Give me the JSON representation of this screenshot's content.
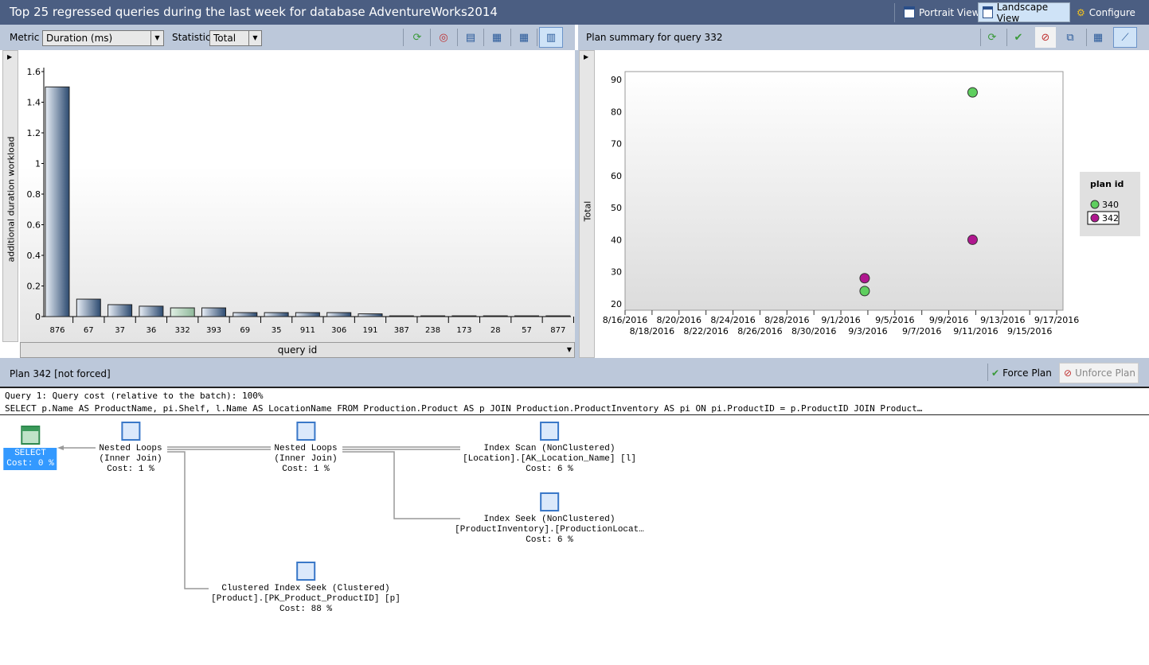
{
  "window": {
    "title": "Top 25 regressed queries during the last week for database AdventureWorks2014",
    "views": [
      {
        "label": "Portrait View",
        "active": false
      },
      {
        "label": "Landscape View",
        "active": true
      },
      {
        "label": "Configure",
        "active": false
      }
    ]
  },
  "left_toolbar": {
    "metric_label": "Metric",
    "metric_value": "Duration (ms)",
    "statistic_label": "Statistic",
    "statistic_value": "Total",
    "icons": [
      "refresh-icon",
      "track-query-icon",
      "view-query-icon",
      "grid-icon",
      "grid-detail-icon",
      "chart-icon"
    ]
  },
  "right_toolbar": {
    "title": "Plan summary for query 332",
    "icons": [
      "refresh-icon",
      "force-plan-icon",
      "unforce-plan-icon",
      "compare-plans-icon",
      "grid-icon",
      "chart-icon"
    ]
  },
  "plan_bar": {
    "title": "Plan 342 [not forced]",
    "force_label": "Force Plan",
    "unforce_label": "Unforce Plan"
  },
  "query": {
    "line1": "Query 1: Query cost (relative to the batch): 100%",
    "line2": "SELECT p.Name AS ProductName, pi.Shelf, l.Name AS LocationName FROM Production.Product AS p JOIN Production.ProductInventory AS pi ON pi.ProductID = p.ProductID JOIN Product…"
  },
  "plan_nodes": {
    "select": {
      "l1": "SELECT",
      "l3": "Cost: 0 %"
    },
    "nl1": {
      "l1": "Nested Loops",
      "l2": "(Inner Join)",
      "l3": "Cost: 1 %"
    },
    "nl2": {
      "l1": "Nested Loops",
      "l2": "(Inner Join)",
      "l3": "Cost: 1 %"
    },
    "scan": {
      "l1": "Index Scan (NonClustered)",
      "l2": "[Location].[AK_Location_Name] [l]",
      "l3": "Cost: 6 %"
    },
    "seek": {
      "l1": "Index Seek (NonClustered)",
      "l2": "[ProductInventory].[ProductionLocat…",
      "l3": "Cost: 6 %"
    },
    "cseek": {
      "l1": "Clustered Index Seek (Clustered)",
      "l2": "[Product].[PK_Product_ProductID] [p]",
      "l3": "Cost: 88 %"
    }
  },
  "chart_data": [
    {
      "type": "bar",
      "title": "",
      "xlabel": "query id",
      "ylabel": "additional duration workload",
      "ylim": [
        0,
        1.6
      ],
      "yticks": [
        "0",
        "0.2",
        "0.4",
        "0.6",
        "0.8",
        "1",
        "1.2",
        "1.4",
        "1.6"
      ],
      "categories": [
        "876",
        "67",
        "37",
        "36",
        "332",
        "393",
        "69",
        "35",
        "911",
        "306",
        "191",
        "387",
        "238",
        "173",
        "28",
        "57",
        "877"
      ],
      "values": [
        1.5,
        0.114,
        0.078,
        0.068,
        0.057,
        0.057,
        0.026,
        0.026,
        0.026,
        0.026,
        0.018,
        0.005,
        0.005,
        0.005,
        0.005,
        0.005,
        0.005
      ],
      "selected": "332",
      "bar_color": "#2c4a70",
      "selected_color": "#8fb89a"
    },
    {
      "type": "scatter",
      "ylabel": "Total",
      "ylim": [
        20,
        90
      ],
      "yticks": [
        "20",
        "30",
        "40",
        "50",
        "60",
        "70",
        "80",
        "90"
      ],
      "xticks_top": [
        "8/16/2016",
        "8/20/2016",
        "8/24/2016",
        "8/28/2016",
        "9/1/2016",
        "9/5/2016",
        "9/9/2016",
        "9/13/2016",
        "9/17/2016"
      ],
      "xticks_bottom": [
        "8/18/2016",
        "8/22/2016",
        "8/26/2016",
        "8/30/2016",
        "9/3/2016",
        "9/7/2016",
        "9/11/2016",
        "9/15/2016"
      ],
      "legend_title": "plan id",
      "legend_position": "right",
      "series": [
        {
          "name": "340",
          "color": "#5fcf5f",
          "points": [
            {
              "x": "9/3/2016",
              "y": 24
            },
            {
              "x": "9/11/2016",
              "y": 86
            }
          ]
        },
        {
          "name": "342",
          "color": "#b0178f",
          "points": [
            {
              "x": "9/3/2016",
              "y": 28
            },
            {
              "x": "9/11/2016",
              "y": 40
            }
          ]
        }
      ]
    }
  ]
}
